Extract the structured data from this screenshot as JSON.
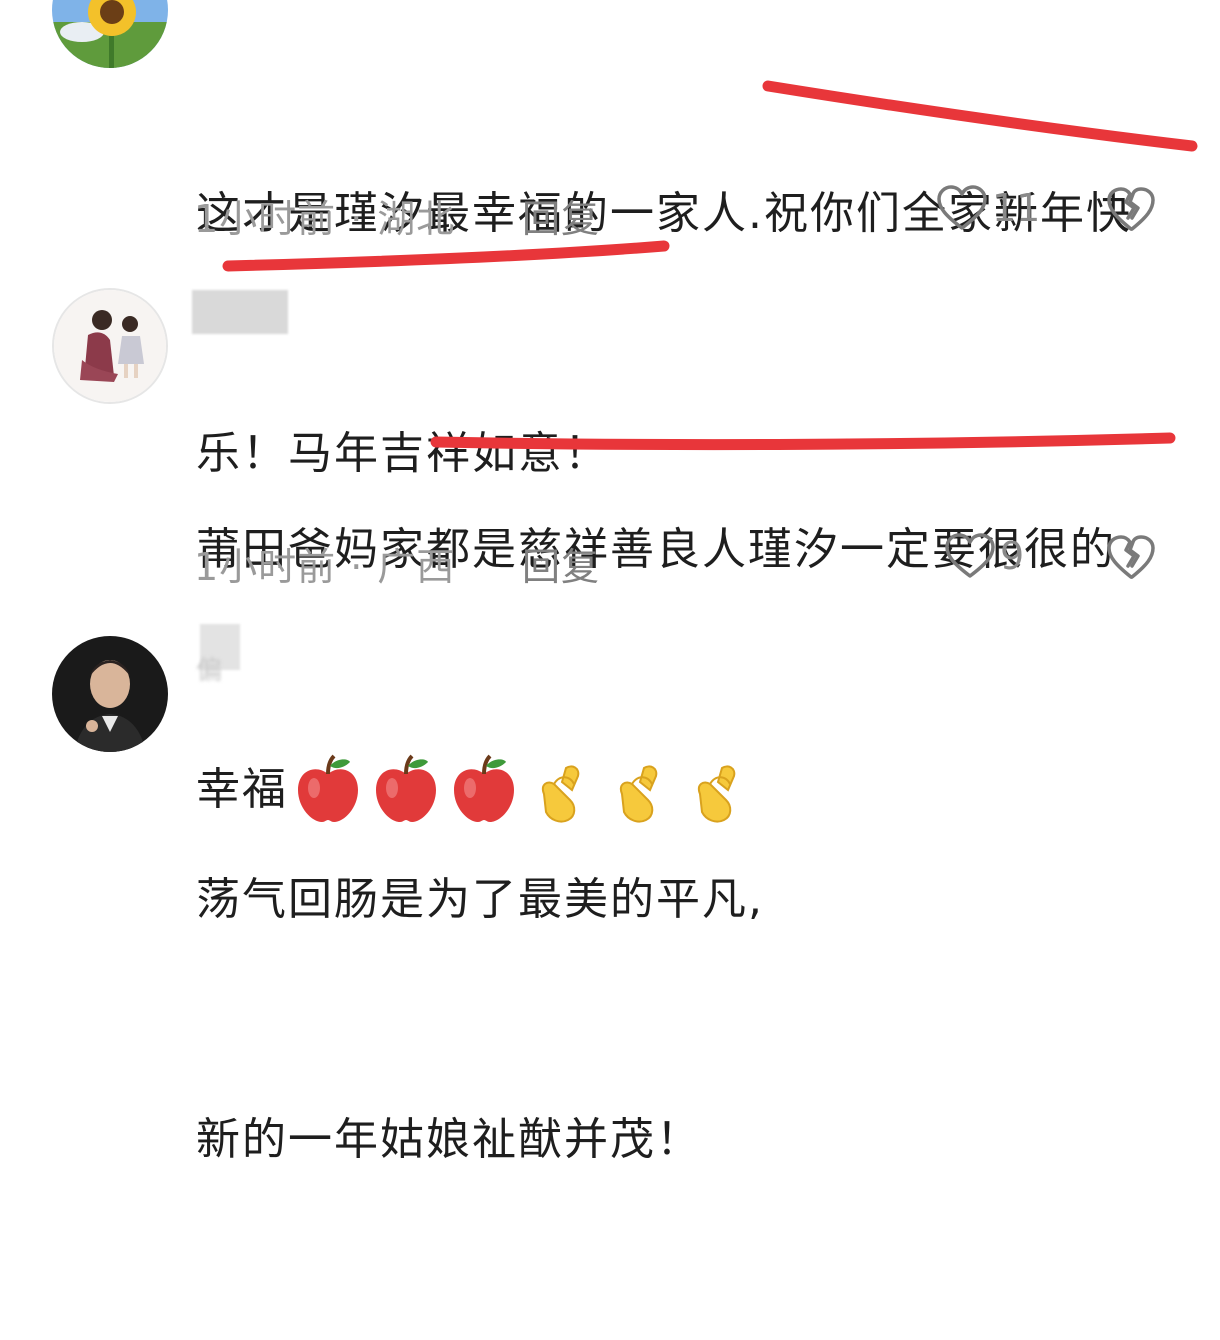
{
  "comments": [
    {
      "text_line1": "这才是瑾汐最幸福的一家人.祝你们全家新年快",
      "text_line2": "乐！马年吉祥如意！",
      "time": "1小时前",
      "location": "湖北",
      "reply": "回复",
      "likes": "11"
    },
    {
      "text_line1": "莆田爸妈家都是慈祥善良人瑾汐一定要很很的",
      "text_line2": "幸福",
      "emojis": [
        "apple",
        "apple",
        "apple",
        "finger-heart",
        "finger-heart",
        "finger-heart"
      ],
      "time": "1小时前",
      "location": "广西",
      "reply": "回复",
      "likes": "9"
    },
    {
      "username_partial": "偏",
      "text_line1": "荡气回肠是为了最美的平凡,",
      "text_line2": "新的一年姑娘祉猷并茂！"
    }
  ],
  "colors": {
    "annotation_red": "#e8363a",
    "meta_gray": "#9a9a9a"
  }
}
